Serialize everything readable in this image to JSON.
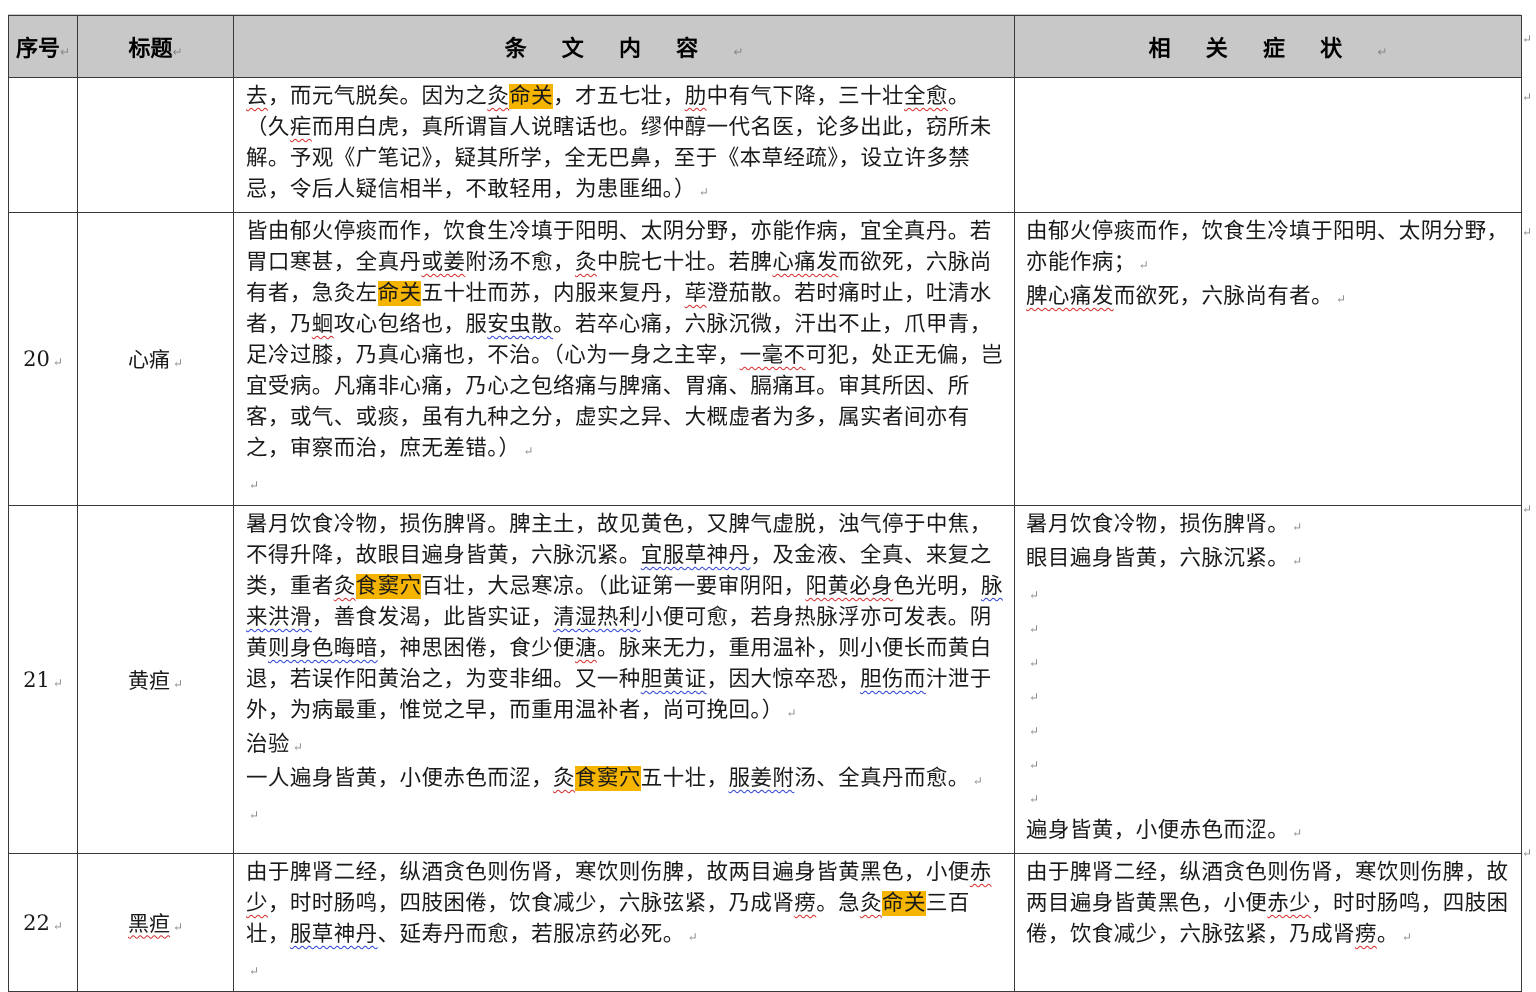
{
  "header": {
    "col_no": "序号",
    "col_title": "标题",
    "col_content": "条文内容",
    "col_symptoms": "相关症状"
  },
  "marker": "↵",
  "rows": [
    {
      "no": "",
      "title": "",
      "content": [
        [
          {
            "t": "去",
            "s": "sq"
          },
          {
            "t": "，而元气脱矣。因为之"
          },
          {
            "t": "灸",
            "s": "sq"
          },
          {
            "t": "命关",
            "s": "hl"
          },
          {
            "t": "，才五七壮，"
          },
          {
            "t": "肋",
            "s": "sq"
          },
          {
            "t": "中有气下降，三十壮"
          },
          {
            "t": "全愈",
            "s": "sq"
          },
          {
            "t": "。"
          }
        ],
        [
          {
            "t": "（久"
          },
          {
            "t": "疟",
            "s": "sq"
          },
          {
            "t": "而用白虎，真所谓盲人说瞎话也。缪仲醇一代名医，论多出此，窃所未解。予观《广笔记》，疑其所学，全无巴鼻，至于《本草经疏》，设立许多禁忌，令后人疑信相半，不敢轻用，为患匪细。）"
          },
          {
            "t": "↵",
            "s": "mark"
          }
        ]
      ],
      "symptoms": []
    },
    {
      "no": "20",
      "title": "心痛",
      "content": [
        [
          {
            "t": "皆由郁火停痰而作，饮食生冷填于阳明、太阴分野，亦能作病，宜全真丹。若胃口寒甚，全真丹"
          },
          {
            "t": "或姜",
            "s": "sq"
          },
          {
            "t": "附汤不愈，"
          },
          {
            "t": "灸",
            "s": "sq"
          },
          {
            "t": "中脘七十壮。若脾"
          },
          {
            "t": "心痛发",
            "s": "sq"
          },
          {
            "t": "而欲死，六脉尚有者，急灸左"
          },
          {
            "t": "命关",
            "s": "hl"
          },
          {
            "t": "五十壮而苏，内服来复丹，"
          },
          {
            "t": "荜",
            "s": "sq"
          },
          {
            "t": "澄茄散。若时痛时止，吐清水者，乃"
          },
          {
            "t": "蛔",
            "s": "sq"
          },
          {
            "t": "攻心包络也，服"
          },
          {
            "t": "安虫散",
            "s": "bq"
          },
          {
            "t": "。若卒心痛，六脉沉微，汗出不止，爪甲青，足冷过膝，乃真心痛也，不治。（心为一身之主宰，"
          },
          {
            "t": "一毫不",
            "s": "sq"
          },
          {
            "t": "可犯，处正无偏，岂宜受病。凡痛非心痛，乃心之包络痛与脾痛、胃痛、膈痛耳。审其所因、所客，或气、或痰，虽有九种之分，虚实之异、大概虚者为多，属实者间亦有之，审察而治，庶无差错。）"
          },
          {
            "t": "↵",
            "s": "mark"
          }
        ],
        [
          {
            "t": "↵",
            "s": "mark"
          }
        ]
      ],
      "symptoms": [
        [
          {
            "t": "由郁火停痰而作，饮食生冷填于阳明、太阴分野，亦能作病；"
          },
          {
            "t": "↵",
            "s": "mark"
          }
        ],
        [
          {
            "t": "脾心痛发",
            "s": "sq"
          },
          {
            "t": "而欲死，六脉尚有者。"
          },
          {
            "t": "↵",
            "s": "mark"
          }
        ]
      ]
    },
    {
      "no": "21",
      "title": "黄疸",
      "content": [
        [
          {
            "t": "暑月饮食冷物，损伤脾肾。脾主土，故见黄色，又脾气虚脱，浊气停于中焦，不得升降，故眼目遍身皆黄，六脉沉紧。"
          },
          {
            "t": "宜服草神丹",
            "s": "bq"
          },
          {
            "t": "，及金液、全真、来复之类，重者"
          },
          {
            "t": "灸",
            "s": "sq"
          },
          {
            "t": "食窦穴",
            "s": "hl"
          },
          {
            "t": "百壮，大忌寒凉。（此证第一要审阴阳，"
          },
          {
            "t": "阳黄必身",
            "s": "sq"
          },
          {
            "t": "色光明，"
          },
          {
            "t": "脉来洪滑",
            "s": "bq"
          },
          {
            "t": "，善食发渴，此皆实证，"
          },
          {
            "t": "清湿热利",
            "s": "bq"
          },
          {
            "t": "小便可愈，若身热脉浮亦可发表。阴黄"
          },
          {
            "t": "则身色晦暗",
            "s": "bq"
          },
          {
            "t": "，神思困倦，食少便"
          },
          {
            "t": "溏",
            "s": "sq"
          },
          {
            "t": "。脉来无力，重用温补，则小便长而黄白退，若误作阳黄治之，为变非细。又一种"
          },
          {
            "t": "胆黄证",
            "s": "bq"
          },
          {
            "t": "，因大惊卒恐，"
          },
          {
            "t": "胆伤而",
            "s": "bq"
          },
          {
            "t": "汁泄于外，为病最重，惟觉之早，而重用温补者，尚可挽回。）"
          },
          {
            "t": "↵",
            "s": "mark"
          }
        ],
        [
          {
            "t": "治验"
          },
          {
            "t": "↵",
            "s": "mark"
          }
        ],
        [
          {
            "t": "一人遍身皆黄，小便赤色而涩，"
          },
          {
            "t": "灸",
            "s": "sq"
          },
          {
            "t": "食窦穴",
            "s": "hl"
          },
          {
            "t": "五十壮，"
          },
          {
            "t": "服姜附",
            "s": "bq"
          },
          {
            "t": "汤、全真丹而愈。"
          },
          {
            "t": "↵",
            "s": "mark"
          }
        ],
        [
          {
            "t": "↵",
            "s": "mark"
          }
        ]
      ],
      "symptoms": [
        [
          {
            "t": "暑月饮食冷物，损伤脾肾。"
          },
          {
            "t": "↵",
            "s": "mark"
          }
        ],
        [
          {
            "t": "眼目遍身皆黄，六脉沉紧。"
          },
          {
            "t": "↵",
            "s": "mark"
          }
        ],
        [
          {
            "t": "↵",
            "s": "mark"
          }
        ],
        [
          {
            "t": "↵",
            "s": "mark"
          }
        ],
        [
          {
            "t": "↵",
            "s": "mark"
          }
        ],
        [
          {
            "t": "↵",
            "s": "mark"
          }
        ],
        [
          {
            "t": "↵",
            "s": "mark"
          }
        ],
        [
          {
            "t": "↵",
            "s": "mark"
          }
        ],
        [
          {
            "t": "↵",
            "s": "mark"
          }
        ],
        [
          {
            "t": "遍身皆黄，小便赤色而涩。"
          },
          {
            "t": "↵",
            "s": "mark"
          }
        ]
      ]
    },
    {
      "no": "22",
      "title": "黑疸",
      "content": [
        [
          {
            "t": "由于脾肾二经，纵酒贪色则伤肾，寒饮则伤脾，故两目遍身皆黄黑色，小便"
          },
          {
            "t": "赤少",
            "s": "sq"
          },
          {
            "t": "，时时肠鸣，四肢困倦，饮食减少，六脉弦紧，乃成肾"
          },
          {
            "t": "痨",
            "s": "sq"
          },
          {
            "t": "。急"
          },
          {
            "t": "灸",
            "s": "sq"
          },
          {
            "t": "命关",
            "s": "hl"
          },
          {
            "t": "三百壮，"
          },
          {
            "t": "服草神丹",
            "s": "bq"
          },
          {
            "t": "、延寿丹而愈，若服凉药必死。"
          },
          {
            "t": "↵",
            "s": "mark"
          }
        ],
        [
          {
            "t": "↵",
            "s": "mark"
          }
        ]
      ],
      "symptoms": [
        [
          {
            "t": "由于脾肾二经，纵酒贪色则伤肾，寒饮则伤脾，故两目遍身皆黄黑色，小便"
          },
          {
            "t": "赤少",
            "s": "sq"
          },
          {
            "t": "，时时肠鸣，四肢困倦，饮食减少，六脉弦紧，乃成肾"
          },
          {
            "t": "痨",
            "s": "sq"
          },
          {
            "t": "。"
          },
          {
            "t": "↵",
            "s": "mark"
          }
        ]
      ]
    }
  ]
}
